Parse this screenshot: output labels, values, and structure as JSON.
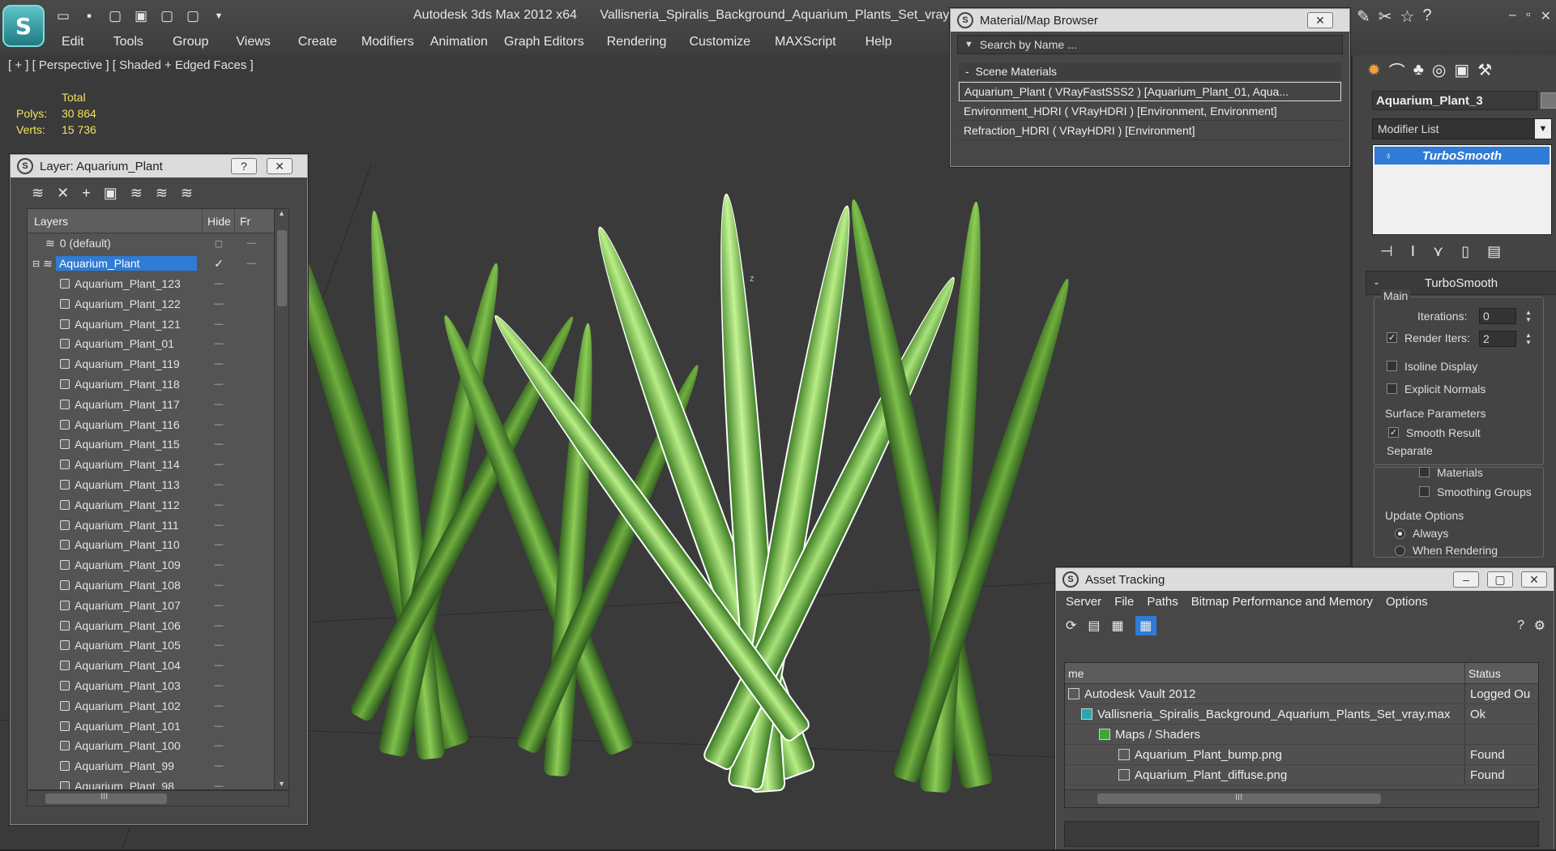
{
  "app": {
    "logo_glyph": "S",
    "title": "Autodesk 3ds Max  2012 x64",
    "file": "Vallisneria_Spiralis_Background_Aquarium_Plants_Set_vray.max"
  },
  "quick_access": [
    "open-icon",
    "save-icon",
    "new-icon",
    "undo-icon",
    "redo-icon",
    "project-icon",
    "dropdown-icon"
  ],
  "menu": [
    "Edit",
    "Tools",
    "Group",
    "Views",
    "Create",
    "Modifiers",
    "Animation",
    "Graph Editors",
    "Rendering",
    "Customize",
    "MAXScript",
    "Help"
  ],
  "viewport": {
    "label": "[ + ] [ Perspective ] [ Shaded + Edged Faces ]",
    "stats": {
      "header": "Total",
      "polys_label": "Polys:",
      "polys": "30 864",
      "verts_label": "Verts:",
      "verts": "15 736"
    },
    "axis_label": "z"
  },
  "layer_window": {
    "title": "Layer: Aquarium_Plant",
    "help": "?",
    "close": "✕",
    "columns": {
      "layers": "Layers",
      "hide": "Hide",
      "freeze": "Fr"
    },
    "default_layer": "0 (default)",
    "active_layer": "Aquarium_Plant",
    "objects": [
      "Aquarium_Plant_123",
      "Aquarium_Plant_122",
      "Aquarium_Plant_121",
      "Aquarium_Plant_01",
      "Aquarium_Plant_119",
      "Aquarium_Plant_118",
      "Aquarium_Plant_117",
      "Aquarium_Plant_116",
      "Aquarium_Plant_115",
      "Aquarium_Plant_114",
      "Aquarium_Plant_113",
      "Aquarium_Plant_112",
      "Aquarium_Plant_111",
      "Aquarium_Plant_110",
      "Aquarium_Plant_109",
      "Aquarium_Plant_108",
      "Aquarium_Plant_107",
      "Aquarium_Plant_106",
      "Aquarium_Plant_105",
      "Aquarium_Plant_104",
      "Aquarium_Plant_103",
      "Aquarium_Plant_102",
      "Aquarium_Plant_101",
      "Aquarium_Plant_100",
      "Aquarium_Plant_99",
      "Aquarium_Plant_98"
    ],
    "hscroll_glyph": "III"
  },
  "material_browser": {
    "title": "Material/Map Browser",
    "close": "✕",
    "search_placeholder": "Search by Name ...",
    "section": "Scene Materials",
    "items": [
      "Aquarium_Plant  ( VRayFastSSS2 )  [Aquarium_Plant_01, Aqua...",
      "Environment_HDRI  ( VRayHDRI )  [Environment, Environment]",
      "Refraction_HDRI  ( VRayHDRI )  [Environment]"
    ]
  },
  "command_panel": {
    "object_name": "Aquarium_Plant_3",
    "modifier_list": "Modifier List",
    "stack_item": "TurboSmooth",
    "rollout_title": "TurboSmooth",
    "main_group": "Main",
    "iterations_label": "Iterations:",
    "iterations": "0",
    "render_iters_label": "Render Iters:",
    "render_iters": "2",
    "isoline": "Isoline Display",
    "explicit_normals": "Explicit Normals",
    "surface_group": "Surface Parameters",
    "smooth_result": "Smooth Result",
    "separate": "Separate",
    "materials": "Materials",
    "smoothing_groups": "Smoothing Groups",
    "update_group": "Update Options",
    "always": "Always",
    "when_rendering": "When Rendering"
  },
  "asset_tracking": {
    "title": "Asset Tracking",
    "menu": [
      "Server",
      "File",
      "Paths",
      "Bitmap Performance and Memory",
      "Options"
    ],
    "columns": {
      "name": "me",
      "status": "Status"
    },
    "rows": [
      {
        "name": "Autodesk Vault 2012",
        "status": "Logged Ou"
      },
      {
        "name": "Vallisneria_Spiralis_Background_Aquarium_Plants_Set_vray.max",
        "status": "Ok"
      },
      {
        "name": "Maps / Shaders",
        "status": ""
      },
      {
        "name": "Aquarium_Plant_bump.png",
        "status": "Found"
      },
      {
        "name": "Aquarium_Plant_diffuse.png",
        "status": "Found"
      }
    ],
    "hscroll_glyph": "III"
  }
}
